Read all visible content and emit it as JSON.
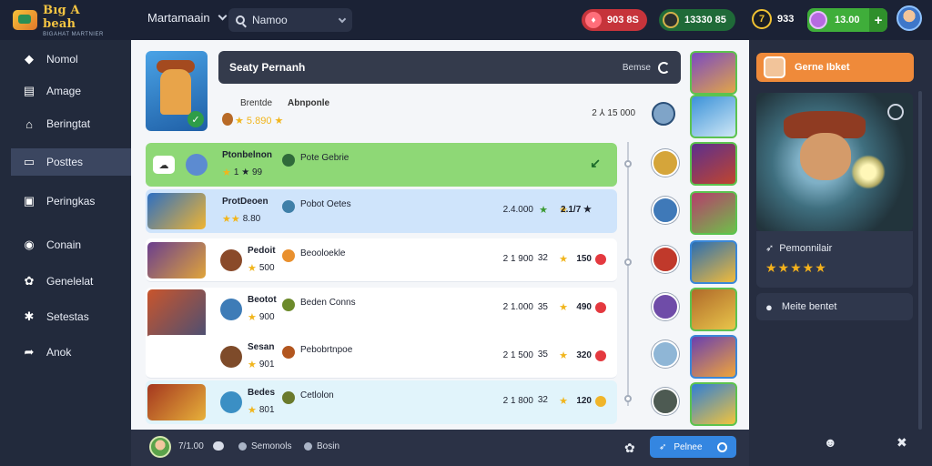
{
  "app": {
    "logo_title": "Bıg A beah",
    "logo_sub": "BIGAHAT MARTNIER"
  },
  "topbar": {
    "menu_label": "Martamaain",
    "search_text": "Namoo",
    "currency_red": "903 8S",
    "currency_green": "13330 85",
    "coin_value": "933",
    "coin_glyph": "7",
    "gem_value": "13.00",
    "gem_plus": "+"
  },
  "sidebar": {
    "items": [
      {
        "label": "Nomol",
        "icon": "bell-icon",
        "glyph": "◆"
      },
      {
        "label": "Amage",
        "icon": "list-icon",
        "glyph": "▤"
      },
      {
        "label": "Beringtat",
        "icon": "home-icon",
        "glyph": "⌂"
      },
      {
        "label": "Posttes",
        "icon": "card-icon",
        "glyph": "▭"
      },
      {
        "label": "Peringkas",
        "icon": "doc-icon",
        "glyph": "▣"
      },
      {
        "label": "Conain",
        "icon": "globe-icon",
        "glyph": "◉"
      },
      {
        "label": "Genelelat",
        "icon": "gear-icon",
        "glyph": "✿"
      },
      {
        "label": "Setestas",
        "icon": "cog-icon",
        "glyph": "✱"
      },
      {
        "label": "Anok",
        "icon": "share-icon",
        "glyph": "➦"
      }
    ],
    "active_index": 3
  },
  "main": {
    "title": "Seaty Pernanh",
    "title_side": "Bemse",
    "sub_a": "Brentde",
    "sub_b": "Abnponle",
    "sub_stars": "★ 5.890 ★",
    "sub_right": "2 ⅄ 15 000",
    "rows": [
      {
        "name": "Ptonbelnon",
        "rating": "1 ★ 99",
        "tag": "Pote Gebrie",
        "value": "",
        "s1": "",
        "s2": "",
        "s3": "",
        "style": "sel"
      },
      {
        "name": "ProtDeoen",
        "rating": "8.80",
        "tag": "Pobot Oetes",
        "value": "2.4.000",
        "s1": "★",
        "s2": "★",
        "s3": "2.1/7 ★",
        "style": "hl"
      },
      {
        "name": "Pedoit",
        "rating": "500",
        "tag": "Beooloekle",
        "value": "2 1 900",
        "s1": "32",
        "s2": "★",
        "s3": "150",
        "style": "plain"
      },
      {
        "name": "Beotot",
        "rating": "900",
        "tag": "Beden Conns",
        "value": "2 1.000",
        "s1": "35",
        "s2": "★",
        "s3": "490",
        "style": "plain"
      },
      {
        "name": "Sesan",
        "rating": "901",
        "tag": "Pebobrtnpoe",
        "value": "2 1 500",
        "s1": "35",
        "s2": "★",
        "s3": "320",
        "style": "plain"
      },
      {
        "name": "Bedes",
        "rating": "801",
        "tag": "Cetlolon",
        "value": "2 1 800",
        "s1": "32",
        "s2": "★",
        "s3": "120",
        "style": "light"
      }
    ]
  },
  "bottombar": {
    "count": "7/1.00",
    "link1": "Semonols",
    "link2": "Bosin",
    "button": "Pelnee"
  },
  "rpanel": {
    "button": "Gerne Ibket",
    "hero_name": "Pemonnilair",
    "stars": "★★★★★",
    "more": "Meite bentet"
  },
  "colors": {
    "accent_orange": "#ef8a3a",
    "accent_blue": "#3486e1",
    "select_green": "#8ed876",
    "highlight_blue": "#cfe4fb"
  }
}
